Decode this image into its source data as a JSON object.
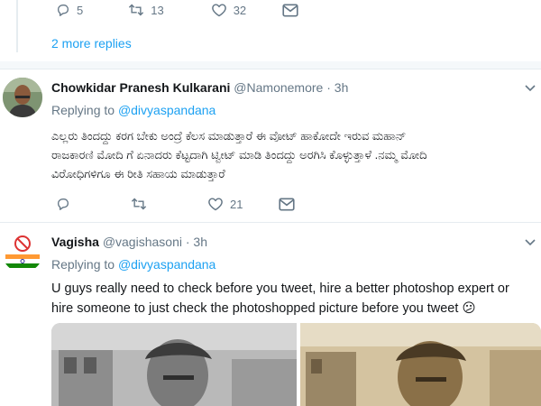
{
  "top_actions": {
    "reply_count": "5",
    "retweet_count": "13",
    "like_count": "32"
  },
  "more_replies": "2 more replies",
  "tweets": [
    {
      "name": "Chowkidar Pranesh Kulkarani",
      "handle": "@Namonemore",
      "time": "3h",
      "replying_label": "Replying to",
      "replying_to": "@divyaspandana",
      "text_lines": [
        "ಎಲ್ಲರು ತಿಂದದ್ದು ಕರಗ ಬೇಕು ಅಂದ್ರೆ ಕೆಲಸ ಮಾಡುತ್ತಾರೆ ಈ ವೋಟ್ ಹಾಕೋದೇ ಇರುವ ಮಹಾನ್",
        "ರಾಜಕಾರಣಿ ಮೋದಿ ಗೆ ಏನಾದರು ಕೆಟ್ಟದಾಗಿ ಟ್ವೀಟ್ ಮಾಡಿ ತಿಂದದ್ದು ಅರಗಿಸಿ ಕೊಳ್ಳುತ್ತಾಳೆ .ನಮ್ಮ ಮೋದಿ",
        "ವಿರೋಧಿಗಳಿಗೂ ಈ ರೀತಿ ಸಹಾಯ ಮಾಡುತ್ತಾರೆ"
      ],
      "reply_count": "",
      "retweet_count": "",
      "like_count": "21"
    },
    {
      "name": "Vagisha",
      "handle": "@vagishasoni",
      "time": "3h",
      "replying_label": "Replying to",
      "replying_to": "@divyaspandana",
      "text_lines": [
        "U guys really need to check before you tweet, hire a better photoshop expert or",
        "hire someone to just check the photoshopped picture before you tweet"
      ],
      "emoji": "😕"
    }
  ],
  "colors": {
    "accent": "#1da1f2",
    "muted": "#657786",
    "border": "#e6ecf0"
  },
  "icons": [
    "reply-icon",
    "retweet-icon",
    "like-icon",
    "message-icon",
    "chevron-down-icon"
  ]
}
